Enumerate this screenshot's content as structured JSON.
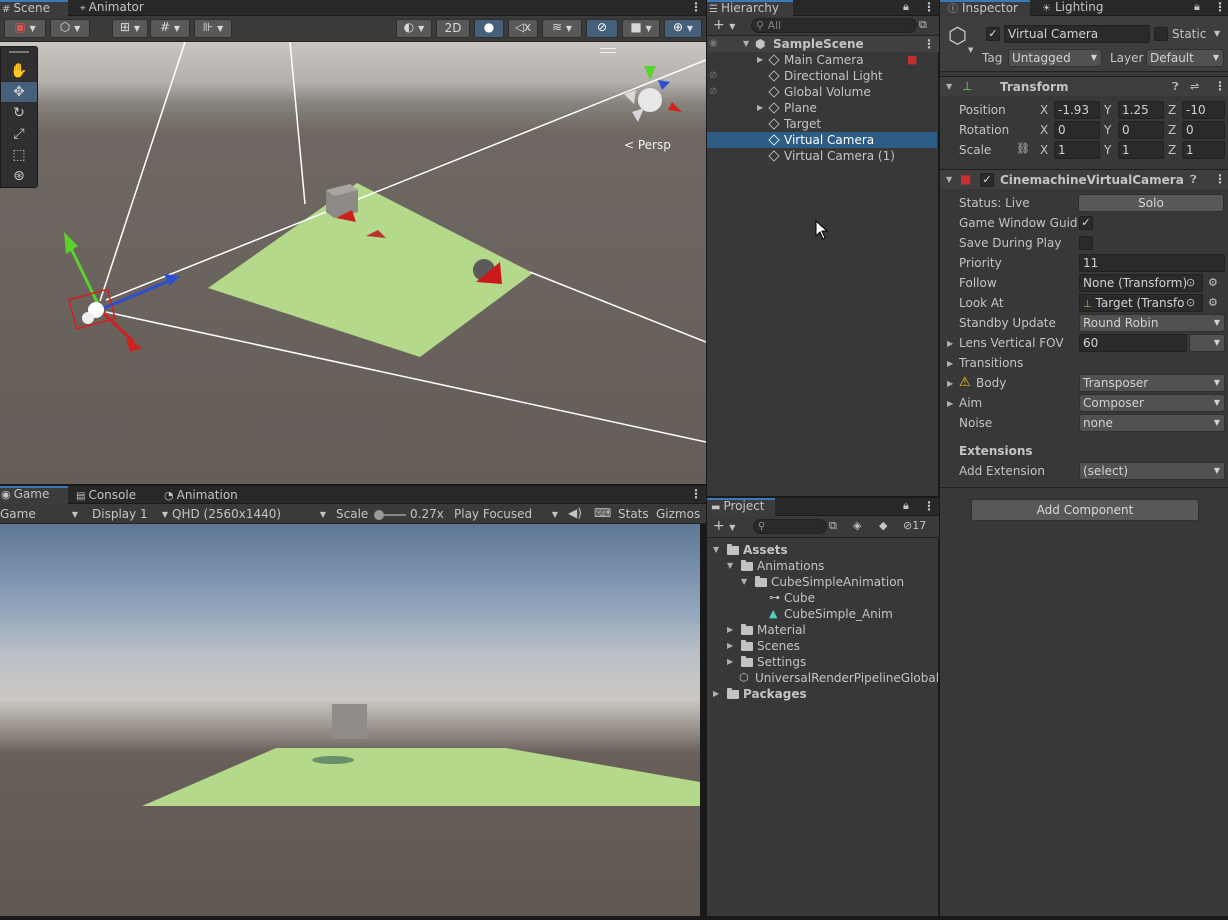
{
  "scene_panel": {
    "tabs": [
      "Scene",
      "Animator"
    ],
    "toolbar": {
      "mode_2d": "2D"
    },
    "persp_label": "< Persp"
  },
  "game_panel": {
    "tabs": [
      "Game",
      "Console",
      "Animation"
    ],
    "toolbar": {
      "game_dropdown": "Game",
      "display_dropdown": "Display 1",
      "resolution_dropdown": "QHD (2560x1440)",
      "scale_label": "Scale",
      "scale_value": "0.27x",
      "play_focused": "Play Focused",
      "stats": "Stats",
      "gizmos": "Gizmos"
    }
  },
  "hierarchy": {
    "tab": "Hierarchy",
    "search_placeholder": "All",
    "scene_name": "SampleScene",
    "items": [
      {
        "label": "Main Camera",
        "expandable": true,
        "selected": false
      },
      {
        "label": "Directional Light",
        "expandable": false,
        "selected": false
      },
      {
        "label": "Global Volume",
        "expandable": false,
        "selected": false
      },
      {
        "label": "Plane",
        "expandable": true,
        "selected": false
      },
      {
        "label": "Target",
        "expandable": false,
        "selected": false
      },
      {
        "label": "Virtual Camera",
        "expandable": false,
        "selected": true
      },
      {
        "label": "Virtual Camera (1)",
        "expandable": false,
        "selected": false
      }
    ]
  },
  "project": {
    "tab": "Project",
    "hidden_count": "17",
    "tree": [
      {
        "label": "Assets",
        "depth": 0,
        "type": "folder",
        "expanded": true,
        "bold": true
      },
      {
        "label": "Animations",
        "depth": 1,
        "type": "folder",
        "expanded": true,
        "bold": false
      },
      {
        "label": "CubeSimpleAnimation",
        "depth": 2,
        "type": "folder",
        "expanded": true,
        "bold": false
      },
      {
        "label": "Cube",
        "depth": 3,
        "type": "controller",
        "expanded": false,
        "bold": false
      },
      {
        "label": "CubeSimple_Anim",
        "depth": 3,
        "type": "anim",
        "expanded": false,
        "bold": false
      },
      {
        "label": "Material",
        "depth": 1,
        "type": "folder",
        "expanded": false,
        "bold": false
      },
      {
        "label": "Scenes",
        "depth": 1,
        "type": "folder",
        "expanded": false,
        "bold": false
      },
      {
        "label": "Settings",
        "depth": 1,
        "type": "folder",
        "expanded": false,
        "bold": false
      },
      {
        "label": "UniversalRenderPipelineGlobalS",
        "depth": 1,
        "type": "asset",
        "expanded": false,
        "bold": false
      },
      {
        "label": "Packages",
        "depth": 0,
        "type": "folder",
        "expanded": false,
        "bold": true
      }
    ]
  },
  "inspector": {
    "tabs": [
      "Inspector",
      "Lighting"
    ],
    "object_name": "Virtual Camera",
    "static_label": "Static",
    "tag_label": "Tag",
    "tag_value": "Untagged",
    "layer_label": "Layer",
    "layer_value": "Default",
    "transform": {
      "title": "Transform",
      "rows": [
        {
          "label": "Position",
          "x": "-1.93",
          "y": "1.25",
          "z": "-10"
        },
        {
          "label": "Rotation",
          "x": "0",
          "y": "0",
          "z": "0"
        },
        {
          "label": "Scale",
          "x": "1",
          "y": "1",
          "z": "1"
        }
      ],
      "axis_x": "X",
      "axis_y": "Y",
      "axis_z": "Z"
    },
    "vcam": {
      "title": "CinemachineVirtualCamera",
      "status_label": "Status: Live",
      "solo_button": "Solo",
      "game_window_guides": "Game Window Guides",
      "save_during_play": "Save During Play",
      "priority_label": "Priority",
      "priority_value": "11",
      "follow_label": "Follow",
      "follow_value": "None (Transform)",
      "look_at_label": "Look At",
      "look_at_value": "Target (Transfo",
      "standby_label": "Standby Update",
      "standby_value": "Round Robin",
      "fov_label": "Lens Vertical FOV",
      "fov_value": "60",
      "transitions_label": "Transitions",
      "body_label": "Body",
      "body_value": "Transposer",
      "aim_label": "Aim",
      "aim_value": "Composer",
      "noise_label": "Noise",
      "noise_value": "none",
      "extensions_heading": "Extensions",
      "add_extension_label": "Add Extension",
      "add_extension_value": "(select)"
    },
    "add_component": "Add Component"
  },
  "colors": {
    "selection": "#2c5d87",
    "accent": "#3a79bb",
    "plane_green": "#b5d98a",
    "panel_bg": "#383838"
  }
}
